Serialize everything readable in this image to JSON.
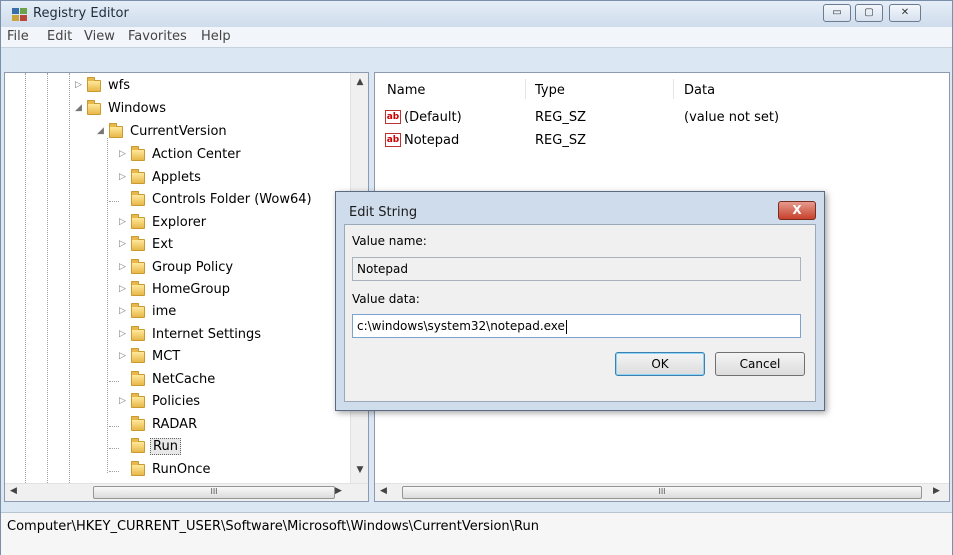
{
  "window": {
    "title": "Registry Editor"
  },
  "menu": [
    "File",
    "Edit",
    "View",
    "Favorites",
    "Help"
  ],
  "tree": {
    "items": [
      {
        "label": "wfs",
        "expander": "▷"
      },
      {
        "label": "Windows",
        "expander": "◢"
      },
      {
        "label": "CurrentVersion",
        "expander": "◢"
      },
      {
        "label": "Action Center",
        "expander": "▷"
      },
      {
        "label": "Applets",
        "expander": "▷"
      },
      {
        "label": "Controls Folder (Wow64)",
        "expander": ""
      },
      {
        "label": "Explorer",
        "expander": "▷"
      },
      {
        "label": "Ext",
        "expander": "▷"
      },
      {
        "label": "Group Policy",
        "expander": "▷"
      },
      {
        "label": "HomeGroup",
        "expander": "▷"
      },
      {
        "label": "ime",
        "expander": "▷"
      },
      {
        "label": "Internet Settings",
        "expander": "▷"
      },
      {
        "label": "MCT",
        "expander": "▷"
      },
      {
        "label": "NetCache",
        "expander": ""
      },
      {
        "label": "Policies",
        "expander": "▷"
      },
      {
        "label": "RADAR",
        "expander": ""
      },
      {
        "label": "Run",
        "expander": "",
        "selected": true
      },
      {
        "label": "RunOnce",
        "expander": ""
      }
    ]
  },
  "list": {
    "headers": {
      "name": "Name",
      "type": "Type",
      "data": "Data"
    },
    "rows": [
      {
        "icon": "ab",
        "name": "(Default)",
        "type": "REG_SZ",
        "data": "(value not set)"
      },
      {
        "icon": "ab",
        "name": "Notepad",
        "type": "REG_SZ",
        "data": ""
      }
    ]
  },
  "scroll": {
    "thumb_glyph": "III",
    "up": "▲",
    "down": "▼",
    "left": "◀",
    "right": "▶"
  },
  "status": {
    "path": "Computer\\HKEY_CURRENT_USER\\Software\\Microsoft\\Windows\\CurrentVersion\\Run"
  },
  "dialog": {
    "title": "Edit String",
    "close_glyph": "X",
    "value_name_label": "Value name:",
    "value_name": "Notepad",
    "value_data_label": "Value data:",
    "value_data": "c:\\windows\\system32\\notepad.exe",
    "ok_label": "OK",
    "cancel_label": "Cancel"
  },
  "window_buttons": {
    "minimize": "▭",
    "maximize": "▢",
    "close": "✕"
  }
}
